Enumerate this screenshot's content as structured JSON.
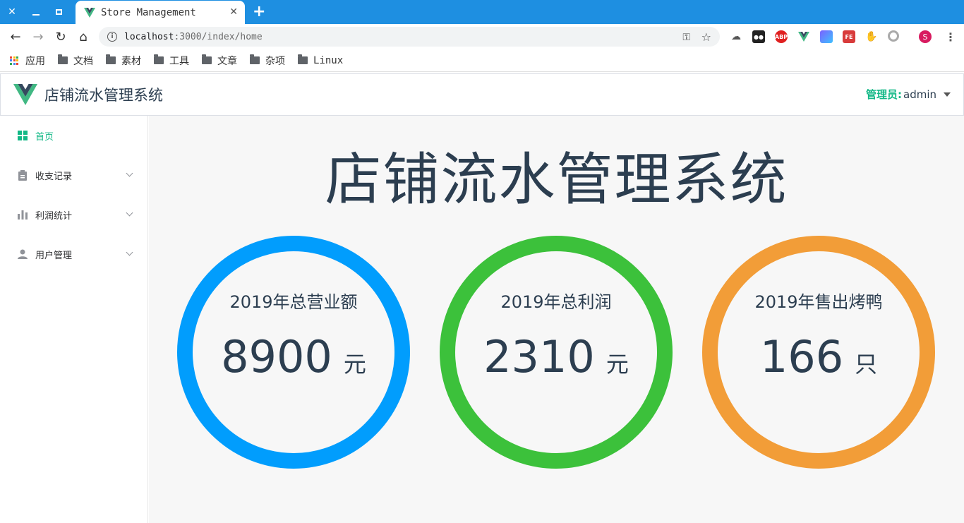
{
  "browser": {
    "tab_title": "Store Management",
    "url_host": "localhost",
    "url_path": ":3000/index/home",
    "bookmarks": [
      "应用",
      "文档",
      "素材",
      "工具",
      "文章",
      "杂项",
      "Linux"
    ],
    "extensions": [
      {
        "name": "abp",
        "label": "ABP",
        "color": "#e02020"
      },
      {
        "name": "fe",
        "label": "FE",
        "color": "#d83b3b"
      }
    ],
    "profile_initial": "S"
  },
  "app": {
    "title": "店铺流水管理系统",
    "user_role": "管理员:",
    "user_name": "admin"
  },
  "sidebar": {
    "items": [
      {
        "label": "首页",
        "icon": "dashboard-icon",
        "active": true
      },
      {
        "label": "收支记录",
        "icon": "clipboard-icon",
        "active": false
      },
      {
        "label": "利润统计",
        "icon": "bar-chart-icon",
        "active": false
      },
      {
        "label": "用户管理",
        "icon": "user-icon",
        "active": false
      }
    ]
  },
  "main": {
    "heading": "店铺流水管理系统",
    "stats": [
      {
        "label": "2019年总营业额",
        "value": "8900",
        "unit": "元",
        "color": "#019dfd"
      },
      {
        "label": "2019年总利润",
        "value": "2310",
        "unit": "元",
        "color": "#3cc13b"
      },
      {
        "label": "2019年售出烤鸭",
        "value": "166",
        "unit": "只",
        "color": "#f29d38"
      }
    ]
  },
  "colors": {
    "accent": "#12b886",
    "tabbar": "#1e8fe1"
  }
}
